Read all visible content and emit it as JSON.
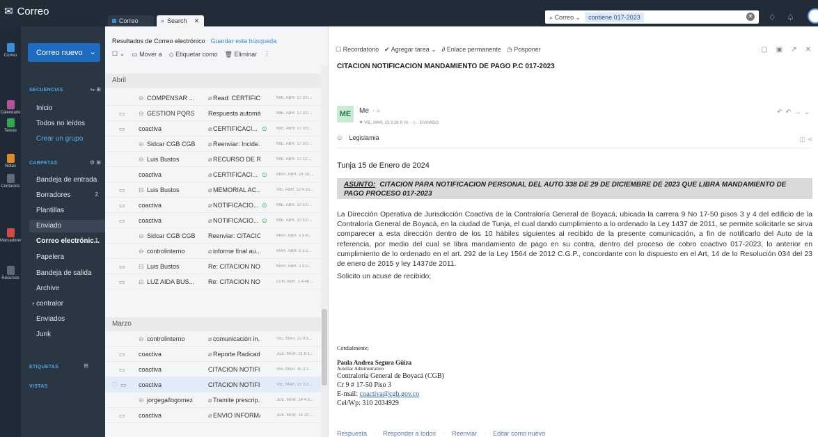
{
  "app": {
    "title": "Correo"
  },
  "tabs": [
    {
      "label": "Correo"
    },
    {
      "label": "Search"
    }
  ],
  "search": {
    "scope": "Correo",
    "query_chip": "contiene 017-2023"
  },
  "rail": [
    {
      "label": "Correo",
      "color": "#3d8ed8"
    },
    {
      "label": "Calendario",
      "color": "#b3539b"
    },
    {
      "label": "Tareas",
      "color": "#2fa84f"
    },
    {
      "label": "Notas",
      "color": "#e08a2e"
    },
    {
      "label": "Contactos",
      "color": "#5b6b7b"
    },
    {
      "label": "Marcadores",
      "color": "#d04a4a"
    },
    {
      "label": "Recursos",
      "color": "#5b6b7b"
    }
  ],
  "sidebar": {
    "new_mail": "Correo nuevo",
    "sections": {
      "secuencias": "SECUENCIAS",
      "carpetas": "CARPETAS",
      "etiquetas": "ETIQUETAS",
      "vistas": "VISTAS"
    },
    "secuencias_items": [
      "Inicio",
      "Todos no leídos",
      "Crear un grupo"
    ],
    "folders": [
      {
        "label": "Bandeja de entrada",
        "count": ""
      },
      {
        "label": "Borradores",
        "count": "2"
      },
      {
        "label": "Plantillas",
        "count": ""
      },
      {
        "label": "Enviado",
        "count": ""
      },
      {
        "label": "Correo electrónic...",
        "count": "1"
      },
      {
        "label": "Papelera",
        "count": ""
      },
      {
        "label": "Bandeja de salida",
        "count": ""
      },
      {
        "label": "Archive",
        "count": ""
      },
      {
        "label": "contralor",
        "count": ""
      },
      {
        "label": "Enviados",
        "count": ""
      },
      {
        "label": "Junk",
        "count": ""
      }
    ]
  },
  "list": {
    "title": "Resultados de Correo electrónico",
    "save_search": "Guardar esta búsqueda",
    "tools": {
      "move": "Mover a",
      "tag": "Etiquetar como",
      "delete": "Eliminar"
    },
    "groups": {
      "april": "Abril",
      "march": "Marzo"
    },
    "rows_april": [
      {
        "from": "COMPENSAR ...",
        "subject": "Read: CERTIFIC...",
        "date": "MIÉ. ABR. 17 3:0..."
      },
      {
        "from": "GESTION PQRS",
        "subject": "Respuesta automá...",
        "date": "MIÉ. ABR. 17 3:0..."
      },
      {
        "from": "coactiva",
        "subject": "CERTIFICACI...",
        "date": "MIÉ. ABR. 17 3:0..."
      },
      {
        "from": "Sidcar CGB CGB",
        "subject": "Reenviar: Incide...",
        "date": "MIÉ. ABR. 17 3:0..."
      },
      {
        "from": "Luis Bustos",
        "subject": "RECURSO DE R...",
        "date": "MIÉ. ABR. 17 12:..."
      },
      {
        "from": "coactiva",
        "subject": "CERTIFICACI...",
        "date": "MAR. ABR. 16 10:..."
      },
      {
        "from": "Luis Bustos",
        "subject": "MEMORIAL AC...",
        "date": "VIE. ABR. 12 4:15..."
      },
      {
        "from": "coactiva",
        "subject": "NOTIFICACIO...",
        "date": "MIÉ. ABR. 10 5:0..."
      },
      {
        "from": "coactiva",
        "subject": "NOTIFICACIO...",
        "date": "MIÉ. ABR. 10 5:0..."
      },
      {
        "from": "Sidcar CGB CGB",
        "subject": "Reenviar: CITACIO...",
        "date": "MAR. ABR. 2 3:4..."
      },
      {
        "from": "controlinterno",
        "subject": "informe final au...",
        "date": "MAR. ABR. 2 3:2..."
      },
      {
        "from": "Luis Bustos",
        "subject": "Re: CITACION NO...",
        "date": "MAR. ABR. 2 3:2..."
      },
      {
        "from": "LUZ AIDA BUS...",
        "subject": "Re: CITACION NO...",
        "date": "LUN. ABR. 1 4:48..."
      }
    ],
    "rows_march": [
      {
        "from": "controlinterno",
        "subject": "comunicación in...",
        "date": "VIE. MAR. 22 4:3..."
      },
      {
        "from": "coactiva",
        "subject": "Reporte Radicado...",
        "date": "JUE. MAR. 21 8:1..."
      },
      {
        "from": "coactiva",
        "subject": "CITACION NOTIFIC...",
        "date": "VIE. MAR. 15 3:2..."
      },
      {
        "from": "coactiva",
        "subject": "CITACION NOTIFIC...",
        "date": "VIE. MAR. 15 3:2..."
      },
      {
        "from": "jorgegallogomez",
        "subject": "Tramite prescrip...",
        "date": "JUE. MAR. 14 4:3..."
      },
      {
        "from": "coactiva",
        "subject": "ENVIO INFORMA...",
        "date": "JUE. MAR. 14 10:..."
      }
    ]
  },
  "pane": {
    "tools": {
      "reminder": "Recordatorio",
      "task": "Agregar tarea",
      "permalink": "Enlace permanente",
      "postpone": "Posponer"
    },
    "subject": "CITACION NOTIFICACION MANDAMIENTO DE PAGO P.C 017-2023",
    "avatar": "ME",
    "sender": "Me",
    "meta_date": "VIE, MAR, 15 3:26 P. M.",
    "meta_status": "ENVIADO",
    "tag": "Legislamia",
    "date_line": "Tunja 15 de Enero de 2024",
    "asunto_label": "ASUNTO:",
    "asunto_text": "CITACION PARA NOTIFICACION PERSONAL DEL AUTO 338  DE 29 DE DICIEMBRE DE 2023 QUE LIBRA MANDAMIENTO DE PAGO PROCESO 017-2023",
    "body": "La Dirección Operativa de Jurisdicción Coactiva de la Contraloría General de Boyacá, ubicada la carrera 9 No 17-50 pisos 3 y 4 del edificio de la Contraloría General de Boyacá, en la ciudad de Tunja, el cual dando cumplimiento a lo ordenado la Ley 1437 de 2011, se permite solicitarle se sirva comparecer a esta dirección dentro de los 10 hábiles siguientes al recibido de la presente comunicación, a fin de notificarlo del Auto de la referencia, por medio del cual se libra mandamiento de pago en su contra, dentro del proceso de cobro coactivo 017-2023, lo anterior en cumplimiento de lo ordenado en el art. 292 de la Ley 1564 de 2012 C.G.P., concordante con lo dispuesto en el Art, 14 de lo Resolución 034 del 23 de enero de 2015 y ley 1437de 2011.",
    "solicito": "Solicito un acuse de recibido;",
    "signature": {
      "closing": "Cordialmente;",
      "name": "Paula Andrea Segura Güiza",
      "role": "Auxiliar Administrativo",
      "org": "Contraloría General de Boyacá (CGB)",
      "address": "Cr 9 # 17-50 Piso 3",
      "email_label": "E-mail: ",
      "email": "coactiva@cgb.gov.co",
      "phone": "Cel/Wp: 310 2034929"
    },
    "reply": {
      "reply": "Respuesta",
      "reply_all": "Responder a todos",
      "forward": "Reenviar",
      "edit_new": "Editar como nuevo"
    }
  }
}
